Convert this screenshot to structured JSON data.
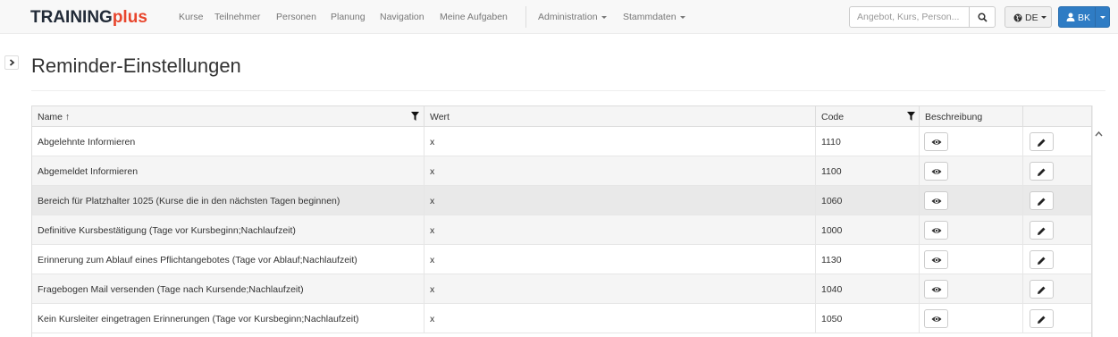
{
  "navbar": {
    "brand_main": "TRAINING",
    "brand_accent": "plus",
    "links": [
      "Kurse",
      "Teilnehmer",
      "Personen",
      "Planung",
      "Navigation",
      "Meine Aufgaben"
    ],
    "dropdowns": [
      "Administration",
      "Stammdaten"
    ],
    "search_placeholder": "Angebot, Kurs, Person...",
    "language": "DE",
    "user": "BK"
  },
  "page": {
    "title": "Reminder-Einstellungen"
  },
  "table": {
    "columns": {
      "name": "Name ↑",
      "wert": "Wert",
      "code": "Code",
      "beschreibung": "Beschreibung"
    },
    "rows": [
      {
        "name": "Abgelehnte Informieren",
        "wert": "x",
        "code": "1110"
      },
      {
        "name": "Abgemeldet Informieren",
        "wert": "x",
        "code": "1100"
      },
      {
        "name": "Bereich für Platzhalter 1025 (Kurse die in den nächsten Tagen beginnen)",
        "wert": "x",
        "code": "1060"
      },
      {
        "name": "Definitive Kursbestätigung (Tage vor Kursbeginn;Nachlaufzeit)",
        "wert": "x",
        "code": "1000"
      },
      {
        "name": "Erinnerung zum Ablauf eines Pflichtangebotes (Tage vor Ablauf;Nachlaufzeit)",
        "wert": "x",
        "code": "1130"
      },
      {
        "name": "Fragebogen Mail versenden (Tage nach Kursende;Nachlaufzeit)",
        "wert": "x",
        "code": "1040"
      },
      {
        "name": "Kein Kursleiter eingetragen Erinnerungen (Tage vor Kursbeginn;Nachlaufzeit)",
        "wert": "x",
        "code": "1050"
      }
    ]
  },
  "colors": {
    "brand_dark": "#222b38",
    "brand_accent": "#e8452c",
    "primary": "#2f7cc4"
  }
}
